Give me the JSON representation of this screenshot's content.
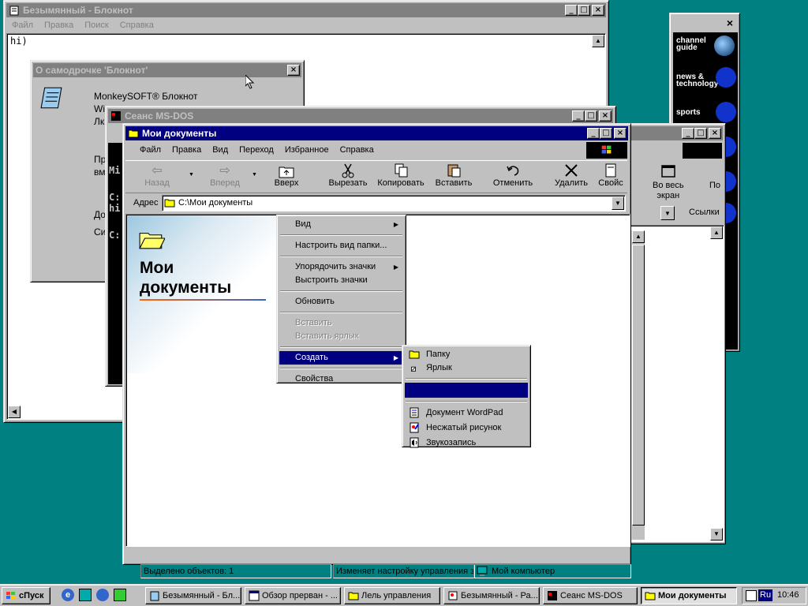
{
  "colors": {
    "desktop": "#008080",
    "titlebar_active": "#000080",
    "titlebar_inactive": "#808080",
    "menu_highlight": "#000080"
  },
  "notepad": {
    "title": "Безымянный - Блокнот",
    "menu": [
      "Файл",
      "Правка",
      "Поиск",
      "Справка"
    ],
    "content": "hi)"
  },
  "about": {
    "title": "О самодрочке 'Блокнот'",
    "product": "MonkeySOFT® Блокнот",
    "line2": "Wi",
    "line3": "Лк",
    "line4": "Пр",
    "line5": "вм",
    "line6": "До",
    "line7": "Си"
  },
  "dos": {
    "title": "Сеанс MS-DOS",
    "lines": [
      "Mi",
      "C:",
      "hi",
      "C:"
    ]
  },
  "browser_back": {
    "btn_fullscreen": "Во весь",
    "btn_fullscreen2": "экран",
    "btn_p": "По",
    "links": "Ссылки"
  },
  "channel": {
    "items": [
      "channel guide",
      "news & technology",
      "sports"
    ]
  },
  "explorer": {
    "title": "Мои документы",
    "menu": [
      "Файл",
      "Правка",
      "Вид",
      "Переход",
      "Избранное",
      "Справка"
    ],
    "toolbar": {
      "back": "Назад",
      "forward": "Вперед",
      "up": "Вверх",
      "cut": "Вырезать",
      "copy": "Копировать",
      "paste": "Вставить",
      "undo": "Отменить",
      "delete": "Удалить",
      "props": "Свойс"
    },
    "address_label": "Адрес",
    "address_value": "C:\\Мои документы",
    "panel_title_1": "Мои",
    "panel_title_2": "документы",
    "status": {
      "selected": "Выделено объектов: 1",
      "hint": "Изменяет настройку управления з",
      "computer": "Мой компьютер"
    }
  },
  "context_menu": {
    "view": "Вид",
    "customize": "Настроить вид папки...",
    "arrange": "Упорядочить значки",
    "line_up": "Выстроить значки",
    "refresh": "Обновить",
    "paste": "Вставить",
    "paste_shortcut": "Вставить ярлык",
    "create": "Создать",
    "properties": "Свойства"
  },
  "submenu": {
    "folder": "Папку",
    "shortcut": "Ярлык",
    "highlighted": "",
    "wordpad": "Документ WordPad",
    "bitmap": "Несжатый рисунок",
    "sound": "Звукозапись"
  },
  "taskbar": {
    "start": "сПуск",
    "tasks": [
      "Безымянный - Бл...",
      "Обзор прерван - ...",
      "Лель управления",
      "Безымянный - Ра...",
      "Сеанс MS-DOS",
      "Мои документы"
    ],
    "lang": "Ru",
    "clock": "10:46"
  }
}
